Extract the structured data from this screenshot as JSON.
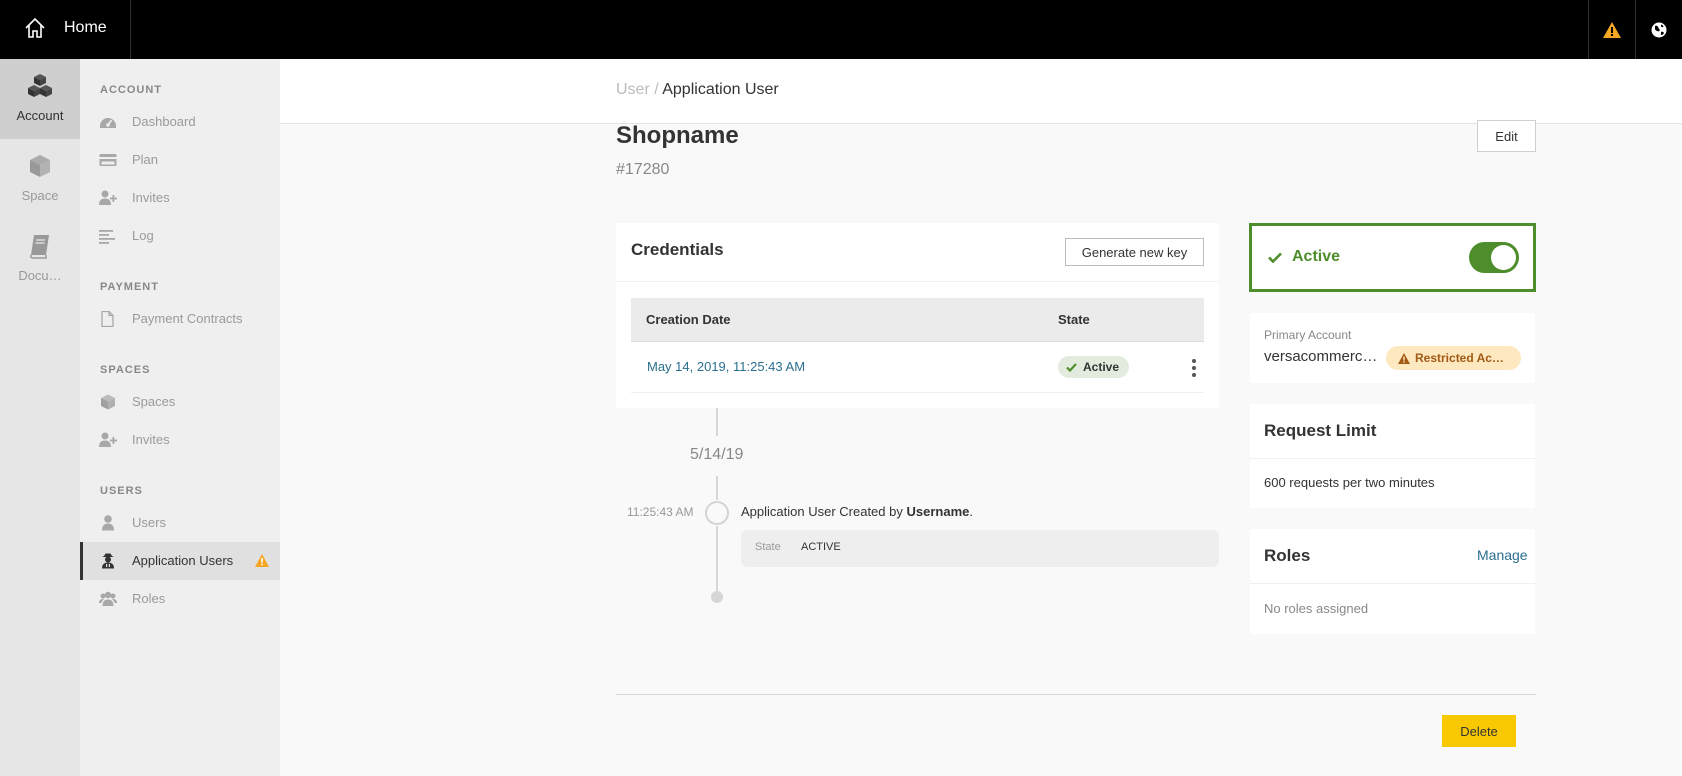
{
  "topbar": {
    "home_label": "Home",
    "home_icon": "home-icon",
    "warning_icon": "warning-icon",
    "globe_icon": "globe-icon",
    "warning_color": "#f5a623"
  },
  "rail": {
    "items": [
      {
        "label": "Account",
        "icon": "cubes-icon",
        "active": true
      },
      {
        "label": "Space",
        "icon": "cube-icon",
        "active": false
      },
      {
        "label": "Docu…",
        "icon": "book-icon",
        "active": false
      }
    ]
  },
  "sidebar": {
    "sections": [
      {
        "title": "ACCOUNT",
        "items": [
          {
            "label": "Dashboard",
            "icon": "dashboard-icon"
          },
          {
            "label": "Plan",
            "icon": "credit-card-icon"
          },
          {
            "label": "Invites",
            "icon": "user-plus-icon"
          },
          {
            "label": "Log",
            "icon": "align-left-icon"
          }
        ]
      },
      {
        "title": "PAYMENT",
        "items": [
          {
            "label": "Payment Contracts",
            "icon": "file-icon"
          }
        ]
      },
      {
        "title": "SPACES",
        "items": [
          {
            "label": "Spaces",
            "icon": "cube-icon"
          },
          {
            "label": "Invites",
            "icon": "user-plus-icon"
          }
        ]
      },
      {
        "title": "USERS",
        "items": [
          {
            "label": "Users",
            "icon": "user-icon"
          },
          {
            "label": "Application Users",
            "icon": "user-secret-icon",
            "active": true,
            "warning": true
          },
          {
            "label": "Roles",
            "icon": "users-icon"
          }
        ]
      }
    ]
  },
  "breadcrumb": {
    "parent": "User /",
    "current": "Application User"
  },
  "page": {
    "title": "Shopname",
    "id": "#17280",
    "edit_label": "Edit",
    "delete_label": "Delete"
  },
  "credentials": {
    "title": "Credentials",
    "generate_label": "Generate new key",
    "columns": [
      "Creation Date",
      "State"
    ],
    "rows": [
      {
        "date": "May 14, 2019, 11:25:43 AM",
        "state": "Active"
      }
    ]
  },
  "timeline": {
    "date": "5/14/19",
    "time": "11:25:43 AM",
    "text_prefix": "Application User Created by ",
    "user": "Username",
    "text_suffix": ".",
    "detail_key": "State",
    "detail_value": "ACTIVE"
  },
  "status": {
    "label": "Active",
    "enabled": true,
    "color": "#4e8d2b"
  },
  "primary_account": {
    "label": "Primary Account",
    "value": "versacommerc…",
    "badge": "Restricted Ac…"
  },
  "request_limit": {
    "title": "Request Limit",
    "value": "600 requests per two minutes"
  },
  "roles": {
    "title": "Roles",
    "manage_label": "Manage",
    "empty_text": "No roles assigned"
  }
}
